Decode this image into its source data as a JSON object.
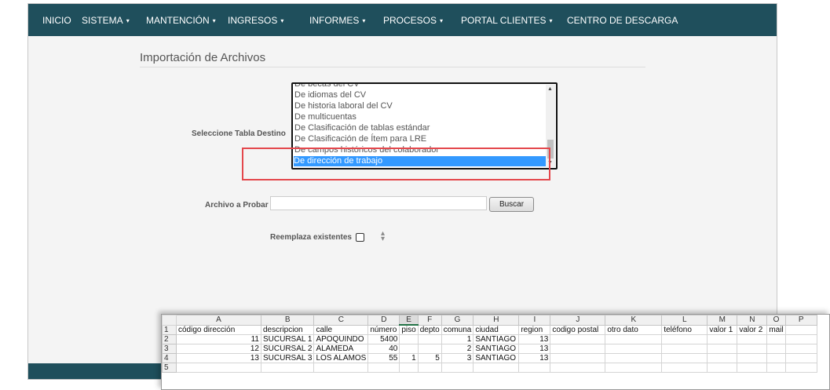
{
  "nav": {
    "items": [
      {
        "label": "INICIO",
        "caret": false
      },
      {
        "label": "SISTEMA",
        "caret": true
      },
      {
        "label": "MANTENCIÓN",
        "caret": true
      },
      {
        "label": "INGRESOS",
        "caret": true
      },
      {
        "label": "INFORMES",
        "caret": true
      },
      {
        "label": "PROCESOS",
        "caret": true
      },
      {
        "label": "PORTAL CLIENTES",
        "caret": true
      },
      {
        "label": "CENTRO DE DESCARGA",
        "caret": false
      }
    ],
    "caret_symbol": "▾"
  },
  "page": {
    "title": "Importación de Archivos",
    "table_label": "Seleccione Tabla Destino",
    "file_label": "Archivo a Probar",
    "file_value": "",
    "browse_button": "Buscar",
    "replace_label": "Reemplaza existentes",
    "replace_checked": false
  },
  "listbox": {
    "items": [
      "De becas del CV",
      "De idiomas del CV",
      "De historia laboral del CV",
      "De multicuentas",
      "De Clasificación de tablas estándar",
      "De Clasificación de Ítem para LRE",
      "De campos históricos del colaborador",
      "De dirección de trabajo"
    ],
    "selected_index": 7
  },
  "colors": {
    "navbar": "#1f4f5c",
    "selection": "#3399ff",
    "highlight": "#e4474c"
  },
  "spreadsheet": {
    "columns": [
      "A",
      "B",
      "C",
      "D",
      "E",
      "F",
      "G",
      "H",
      "I",
      "J",
      "K",
      "L",
      "M",
      "N",
      "O",
      "P"
    ],
    "active_column": "E",
    "rows": [
      {
        "n": "1",
        "cells": [
          "código dirección",
          "descripcion",
          "calle",
          "número",
          "piso",
          "depto",
          "comuna",
          "ciudad",
          "region",
          "codigo postal",
          "otro dato",
          "teléfono",
          "valor 1",
          "valor 2",
          "mail",
          ""
        ]
      },
      {
        "n": "2",
        "cells": [
          "11",
          "SUCURSAL 1",
          "APOQUINDO",
          "5400",
          "",
          "",
          "1",
          "SANTIAGO",
          "13",
          "",
          "",
          "",
          "",
          "",
          "",
          ""
        ]
      },
      {
        "n": "3",
        "cells": [
          "12",
          "SUCURSAL 2",
          "ALAMEDA",
          "40",
          "",
          "",
          "2",
          "SANTIAGO",
          "13",
          "",
          "",
          "",
          "",
          "",
          "",
          ""
        ]
      },
      {
        "n": "4",
        "cells": [
          "13",
          "SUCURSAL 3",
          "LOS ALAMOS",
          "55",
          "1",
          "5",
          "3",
          "SANTIAGO",
          "13",
          "",
          "",
          "",
          "",
          "",
          "",
          ""
        ]
      },
      {
        "n": "5",
        "cells": [
          "",
          "",
          "",
          "",
          "",
          "",
          "",
          "",
          "",
          "",
          "",
          "",
          "",
          "",
          "",
          ""
        ]
      }
    ]
  }
}
